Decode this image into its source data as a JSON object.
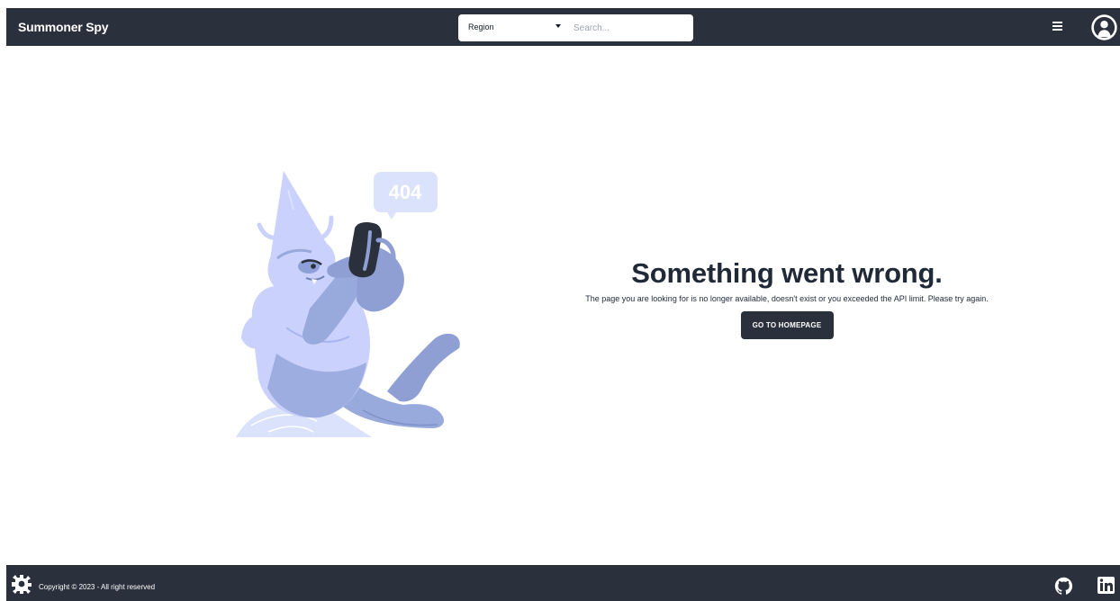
{
  "header": {
    "brand": "Summoner Spy",
    "region_selector": {
      "selected": "Region"
    },
    "search": {
      "placeholder": "Search..."
    },
    "menu_icon": "hamburger-menu-icon",
    "avatar_icon": "user-avatar-icon"
  },
  "error": {
    "illustration_code": "404",
    "title": "Something went wrong.",
    "message": "The page you are looking for is no longer available, doesn't exist or you exceeded the API limit. Please try again.",
    "button_label": "GO TO HOMEPAGE"
  },
  "footer": {
    "logo_icon": "gear-logo-icon",
    "copyright": "Copyright © 2023 - All right reserved",
    "social": [
      "github-icon",
      "linkedin-icon"
    ]
  },
  "colors": {
    "navbar_background": "#2a303c",
    "illustration_light": "#c9d1fc",
    "illustration_mid": "#98a9dc",
    "illustration_dark": "#7587c1"
  }
}
